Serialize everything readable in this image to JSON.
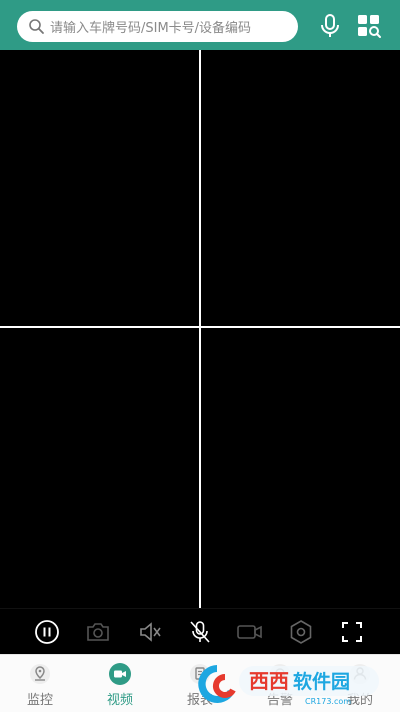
{
  "search": {
    "placeholder": "请输入车牌号码/SIM卡号/设备编码"
  },
  "colors": {
    "accent": "#2f9b86",
    "video_bg": "#000000",
    "tab_active": "#2f9b86"
  },
  "header": {
    "icons": [
      "microphone-icon",
      "grid-search-icon"
    ]
  },
  "toolbar": {
    "icons": [
      "pause-icon",
      "camera-icon",
      "speaker-mute-icon",
      "mic-mute-icon",
      "video-record-icon",
      "settings-hex-icon",
      "fullscreen-icon"
    ]
  },
  "tabs": [
    {
      "label": "监控",
      "icon": "location-icon",
      "active": false
    },
    {
      "label": "视频",
      "icon": "video-camera-icon",
      "active": true
    },
    {
      "label": "报表",
      "icon": "report-icon",
      "active": false
    },
    {
      "label": "告警",
      "icon": "alarm-icon",
      "active": false
    },
    {
      "label": "我的",
      "icon": "user-icon",
      "active": false
    }
  ],
  "watermark": {
    "text": "西西软件园",
    "site": "CR173.com"
  }
}
